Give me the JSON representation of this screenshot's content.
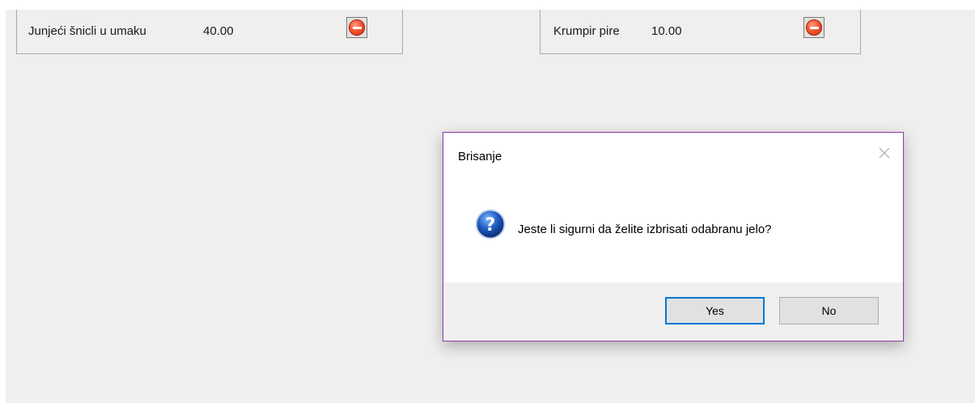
{
  "items": [
    {
      "name": "Junjeći šnicli u umaku",
      "price": "40.00",
      "remove_icon": "minus-circle-icon"
    },
    {
      "name": "Krumpir pire",
      "price": "10.00",
      "remove_icon": "minus-circle-icon"
    }
  ],
  "dialog": {
    "title": "Brisanje",
    "message": "Jeste li sigurni da želite izbrisati odabranu jelo?",
    "icon": "question-icon",
    "buttons": {
      "yes": "Yes",
      "no": "No"
    },
    "accent_color": "#0078d7",
    "border_color": "#8a3aa8"
  }
}
